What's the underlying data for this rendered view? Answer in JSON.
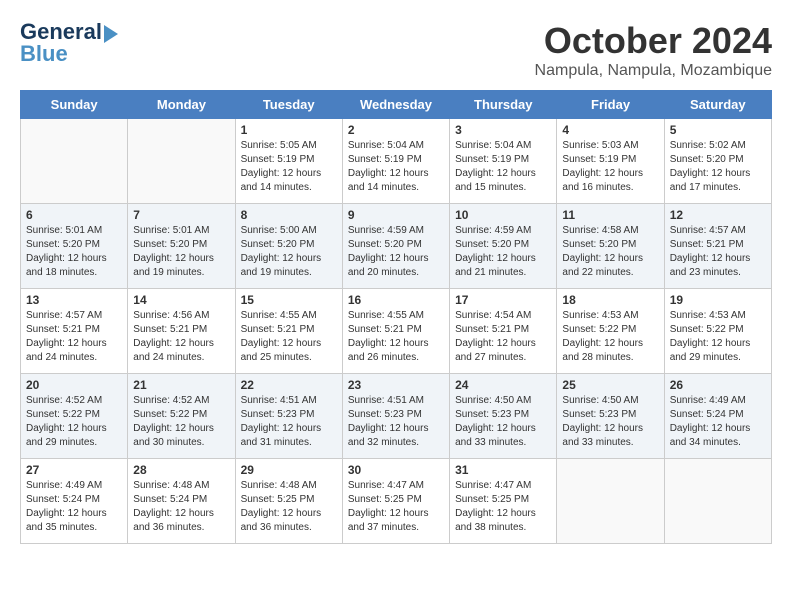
{
  "header": {
    "logo_line1": "General",
    "logo_line2": "Blue",
    "title": "October 2024",
    "location": "Nampula, Nampula, Mozambique"
  },
  "days_of_week": [
    "Sunday",
    "Monday",
    "Tuesday",
    "Wednesday",
    "Thursday",
    "Friday",
    "Saturday"
  ],
  "weeks": [
    [
      {
        "day": "",
        "info": ""
      },
      {
        "day": "",
        "info": ""
      },
      {
        "day": "1",
        "info": "Sunrise: 5:05 AM\nSunset: 5:19 PM\nDaylight: 12 hours\nand 14 minutes."
      },
      {
        "day": "2",
        "info": "Sunrise: 5:04 AM\nSunset: 5:19 PM\nDaylight: 12 hours\nand 14 minutes."
      },
      {
        "day": "3",
        "info": "Sunrise: 5:04 AM\nSunset: 5:19 PM\nDaylight: 12 hours\nand 15 minutes."
      },
      {
        "day": "4",
        "info": "Sunrise: 5:03 AM\nSunset: 5:19 PM\nDaylight: 12 hours\nand 16 minutes."
      },
      {
        "day": "5",
        "info": "Sunrise: 5:02 AM\nSunset: 5:20 PM\nDaylight: 12 hours\nand 17 minutes."
      }
    ],
    [
      {
        "day": "6",
        "info": "Sunrise: 5:01 AM\nSunset: 5:20 PM\nDaylight: 12 hours\nand 18 minutes."
      },
      {
        "day": "7",
        "info": "Sunrise: 5:01 AM\nSunset: 5:20 PM\nDaylight: 12 hours\nand 19 minutes."
      },
      {
        "day": "8",
        "info": "Sunrise: 5:00 AM\nSunset: 5:20 PM\nDaylight: 12 hours\nand 19 minutes."
      },
      {
        "day": "9",
        "info": "Sunrise: 4:59 AM\nSunset: 5:20 PM\nDaylight: 12 hours\nand 20 minutes."
      },
      {
        "day": "10",
        "info": "Sunrise: 4:59 AM\nSunset: 5:20 PM\nDaylight: 12 hours\nand 21 minutes."
      },
      {
        "day": "11",
        "info": "Sunrise: 4:58 AM\nSunset: 5:20 PM\nDaylight: 12 hours\nand 22 minutes."
      },
      {
        "day": "12",
        "info": "Sunrise: 4:57 AM\nSunset: 5:21 PM\nDaylight: 12 hours\nand 23 minutes."
      }
    ],
    [
      {
        "day": "13",
        "info": "Sunrise: 4:57 AM\nSunset: 5:21 PM\nDaylight: 12 hours\nand 24 minutes."
      },
      {
        "day": "14",
        "info": "Sunrise: 4:56 AM\nSunset: 5:21 PM\nDaylight: 12 hours\nand 24 minutes."
      },
      {
        "day": "15",
        "info": "Sunrise: 4:55 AM\nSunset: 5:21 PM\nDaylight: 12 hours\nand 25 minutes."
      },
      {
        "day": "16",
        "info": "Sunrise: 4:55 AM\nSunset: 5:21 PM\nDaylight: 12 hours\nand 26 minutes."
      },
      {
        "day": "17",
        "info": "Sunrise: 4:54 AM\nSunset: 5:21 PM\nDaylight: 12 hours\nand 27 minutes."
      },
      {
        "day": "18",
        "info": "Sunrise: 4:53 AM\nSunset: 5:22 PM\nDaylight: 12 hours\nand 28 minutes."
      },
      {
        "day": "19",
        "info": "Sunrise: 4:53 AM\nSunset: 5:22 PM\nDaylight: 12 hours\nand 29 minutes."
      }
    ],
    [
      {
        "day": "20",
        "info": "Sunrise: 4:52 AM\nSunset: 5:22 PM\nDaylight: 12 hours\nand 29 minutes."
      },
      {
        "day": "21",
        "info": "Sunrise: 4:52 AM\nSunset: 5:22 PM\nDaylight: 12 hours\nand 30 minutes."
      },
      {
        "day": "22",
        "info": "Sunrise: 4:51 AM\nSunset: 5:23 PM\nDaylight: 12 hours\nand 31 minutes."
      },
      {
        "day": "23",
        "info": "Sunrise: 4:51 AM\nSunset: 5:23 PM\nDaylight: 12 hours\nand 32 minutes."
      },
      {
        "day": "24",
        "info": "Sunrise: 4:50 AM\nSunset: 5:23 PM\nDaylight: 12 hours\nand 33 minutes."
      },
      {
        "day": "25",
        "info": "Sunrise: 4:50 AM\nSunset: 5:23 PM\nDaylight: 12 hours\nand 33 minutes."
      },
      {
        "day": "26",
        "info": "Sunrise: 4:49 AM\nSunset: 5:24 PM\nDaylight: 12 hours\nand 34 minutes."
      }
    ],
    [
      {
        "day": "27",
        "info": "Sunrise: 4:49 AM\nSunset: 5:24 PM\nDaylight: 12 hours\nand 35 minutes."
      },
      {
        "day": "28",
        "info": "Sunrise: 4:48 AM\nSunset: 5:24 PM\nDaylight: 12 hours\nand 36 minutes."
      },
      {
        "day": "29",
        "info": "Sunrise: 4:48 AM\nSunset: 5:25 PM\nDaylight: 12 hours\nand 36 minutes."
      },
      {
        "day": "30",
        "info": "Sunrise: 4:47 AM\nSunset: 5:25 PM\nDaylight: 12 hours\nand 37 minutes."
      },
      {
        "day": "31",
        "info": "Sunrise: 4:47 AM\nSunset: 5:25 PM\nDaylight: 12 hours\nand 38 minutes."
      },
      {
        "day": "",
        "info": ""
      },
      {
        "day": "",
        "info": ""
      }
    ]
  ]
}
